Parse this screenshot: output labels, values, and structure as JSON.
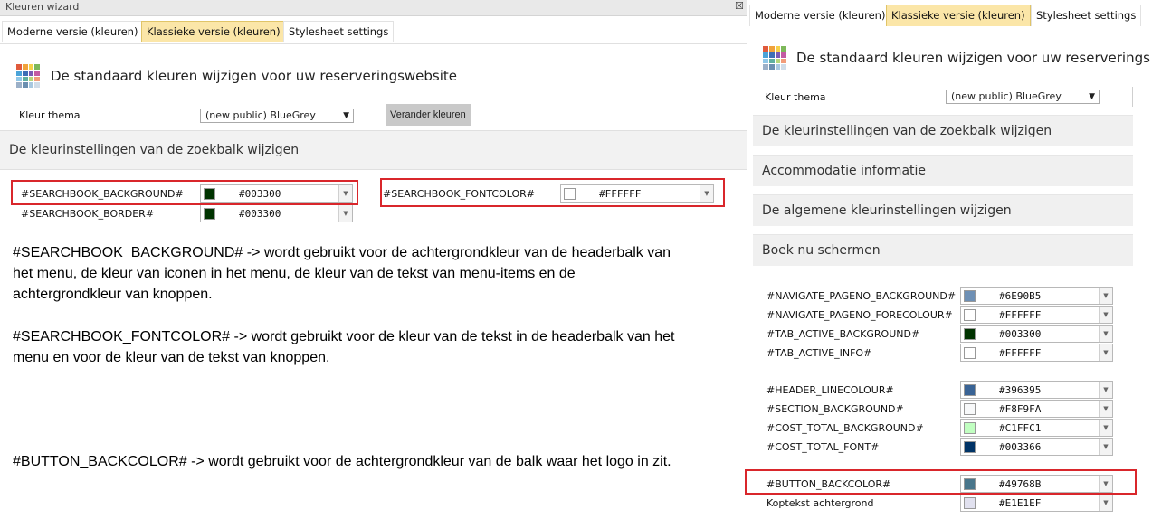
{
  "window": {
    "title": "Kleuren wizard",
    "close_glyph": "☒"
  },
  "tabs": [
    "Moderne versie (kleuren)",
    "Klassieke versie (kleuren)",
    "Stylesheet settings"
  ],
  "heading": "De standaard kleuren wijzigen voor uw reserveringswebsite",
  "theme": {
    "label": "Kleur thema",
    "value": "(new public) BlueGrey",
    "button": "Verander kleuren"
  },
  "sections_left": {
    "searchbar": "De kleurinstellingen van de zoekbalk wijzigen"
  },
  "left_fields": [
    {
      "name": "#SEARCHBOOK_BACKGROUND#",
      "hex": "#003300",
      "swatch": "#003300"
    },
    {
      "name": "#SEARCHBOOK_BORDER#",
      "hex": "#003300",
      "swatch": "#003300"
    },
    {
      "name": "#SEARCHBOOK_FONTCOLOR#",
      "hex": "#FFFFFF",
      "swatch": "#FFFFFF"
    }
  ],
  "notes": {
    "bg1": "#SEARCHBOOK_BACKGROUND# -> wordt gebruikt voor de achtergrondkleur van de headerbalk van",
    "bg2": "het menu, de kleur van iconen in het menu, de kleur van de tekst van menu-items en de",
    "bg3": "achtergrondkleur van knoppen.",
    "fc1": "#SEARCHBOOK_FONTCOLOR# -> wordt gebruikt voor de kleur van de tekst in de headerbalk van het",
    "fc2": "menu en voor de kleur van de tekst van knoppen.",
    "btn": "#BUTTON_BACKCOLOR# -> wordt gebruikt voor de achtergrondkleur van de balk waar het logo in zit."
  },
  "right_heading": "De standaard kleuren wijzigen voor uw reserverings",
  "right_sections": [
    "De kleurinstellingen van de zoekbalk wijzigen",
    "Accommodatie informatie",
    "De algemene kleurinstellingen wijzigen",
    "Boek nu schermen"
  ],
  "right_fields": [
    {
      "name": "#NAVIGATE_PAGENO_BACKGROUND#",
      "hex": "#6E90B5",
      "swatch": "#6E90B5"
    },
    {
      "name": "#NAVIGATE_PAGENO_FORECOLOUR#",
      "hex": "#FFFFFF",
      "swatch": "#FFFFFF"
    },
    {
      "name": "#TAB_ACTIVE_BACKGROUND#",
      "hex": "#003300",
      "swatch": "#003300"
    },
    {
      "name": "#TAB_ACTIVE_INFO#",
      "hex": "#FFFFFF",
      "swatch": "#FFFFFF"
    },
    {
      "name": "#HEADER_LINECOLOUR#",
      "hex": "#396395",
      "swatch": "#396395"
    },
    {
      "name": "#SECTION_BACKGROUND#",
      "hex": "#F8F9FA",
      "swatch": "#F8F9FA"
    },
    {
      "name": "#COST_TOTAL_BACKGROUND#",
      "hex": "#C1FFC1",
      "swatch": "#C1FFC1"
    },
    {
      "name": "#COST_TOTAL_FONT#",
      "hex": "#003366",
      "swatch": "#003366"
    },
    {
      "name": "#BUTTON_BACKCOLOR#",
      "hex": "#49768B",
      "swatch": "#49768B"
    },
    {
      "name": "Koptekst achtergrond",
      "hex": "#E1E1EF",
      "swatch": "#E1E1EF"
    }
  ],
  "colors": {
    "active_tab": "#fbe6a8",
    "highlight": "#d9262b"
  },
  "icons": {
    "logo": "color-grid-icon",
    "dropdown": "chevron-down-icon",
    "close": "close-icon"
  }
}
